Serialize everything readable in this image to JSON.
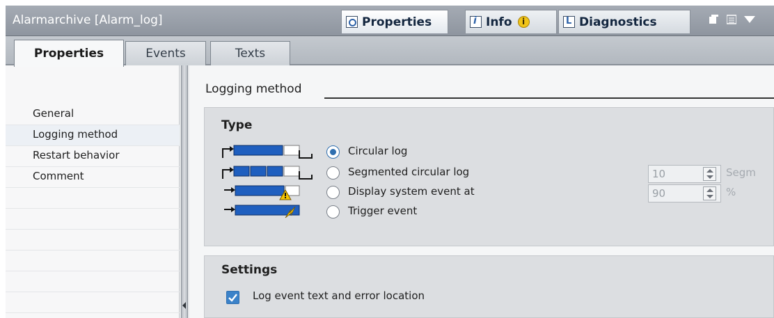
{
  "window": {
    "title": "Alarmarchive [Alarm_log]",
    "tabs": [
      {
        "label": "Properties",
        "icon": "properties-icon",
        "active": true
      },
      {
        "label": "Info",
        "icon": "info-icon",
        "active": false,
        "badge": "i"
      },
      {
        "label": "Diagnostics",
        "icon": "diagnostics-icon",
        "active": false
      }
    ],
    "controls": [
      "restore-icon",
      "list-icon",
      "dropdown-icon"
    ]
  },
  "subtabs": [
    {
      "label": "Properties",
      "active": true
    },
    {
      "label": "Events",
      "active": false
    },
    {
      "label": "Texts",
      "active": false
    }
  ],
  "nav": {
    "items": [
      {
        "label": "General",
        "selected": false
      },
      {
        "label": "Logging method",
        "selected": true
      },
      {
        "label": "Restart behavior",
        "selected": false
      },
      {
        "label": "Comment",
        "selected": false
      }
    ]
  },
  "main": {
    "section_title": "Logging method",
    "type_group": {
      "title": "Type",
      "options": [
        {
          "label": "Circular log",
          "checked": true,
          "icon": "circular-log-icon"
        },
        {
          "label": "Segmented circular log",
          "checked": false,
          "icon": "segmented-log-icon"
        },
        {
          "label": "Display system event at",
          "checked": false,
          "icon": "system-event-icon"
        },
        {
          "label": "Trigger event",
          "checked": false,
          "icon": "trigger-event-icon"
        }
      ],
      "segments_field": {
        "value": "10",
        "unit": "Segm"
      },
      "percent_field": {
        "value": "90",
        "unit": "%"
      }
    },
    "settings_group": {
      "title": "Settings",
      "log_event_text": {
        "label": "Log event text and error location",
        "checked": true
      }
    }
  },
  "colors": {
    "accent": "#2f6fb0",
    "titlebar": "#9aa1aa",
    "panel": "#dcdee1"
  }
}
